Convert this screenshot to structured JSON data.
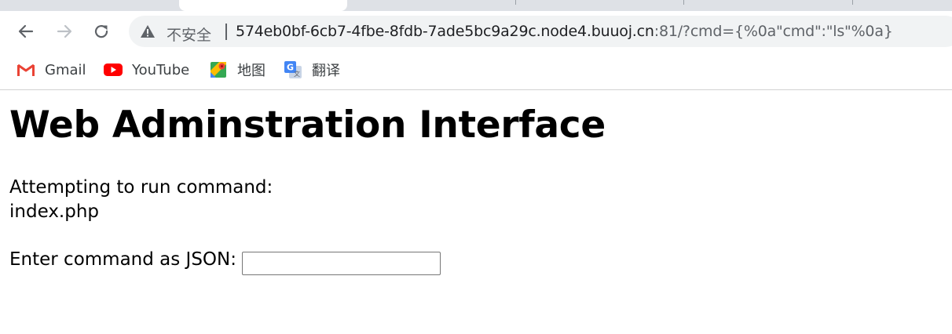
{
  "browser": {
    "omnibox": {
      "security_label": "不安全",
      "url_host": "574eb0bf-6cb7-4fbe-8fdb-7ade5bc9a29c.node4.buuoj.cn",
      "url_rest": ":81/?cmd={%0a\"cmd\":\"ls\"%0a}"
    },
    "icons": {
      "back": "back-arrow-icon",
      "forward": "forward-arrow-icon",
      "reload": "reload-icon",
      "warning": "warning-triangle-icon"
    },
    "bookmarks": [
      {
        "label": "Gmail",
        "icon": "gmail-icon"
      },
      {
        "label": "YouTube",
        "icon": "youtube-icon"
      },
      {
        "label": "地图",
        "icon": "maps-icon"
      },
      {
        "label": "翻译",
        "icon": "translate-icon"
      }
    ]
  },
  "page": {
    "title": "Web Adminstration Interface",
    "status_label": "Attempting to run command:",
    "command_output": "index.php",
    "prompt_label": "Enter command as JSON:",
    "command_input_value": ""
  }
}
